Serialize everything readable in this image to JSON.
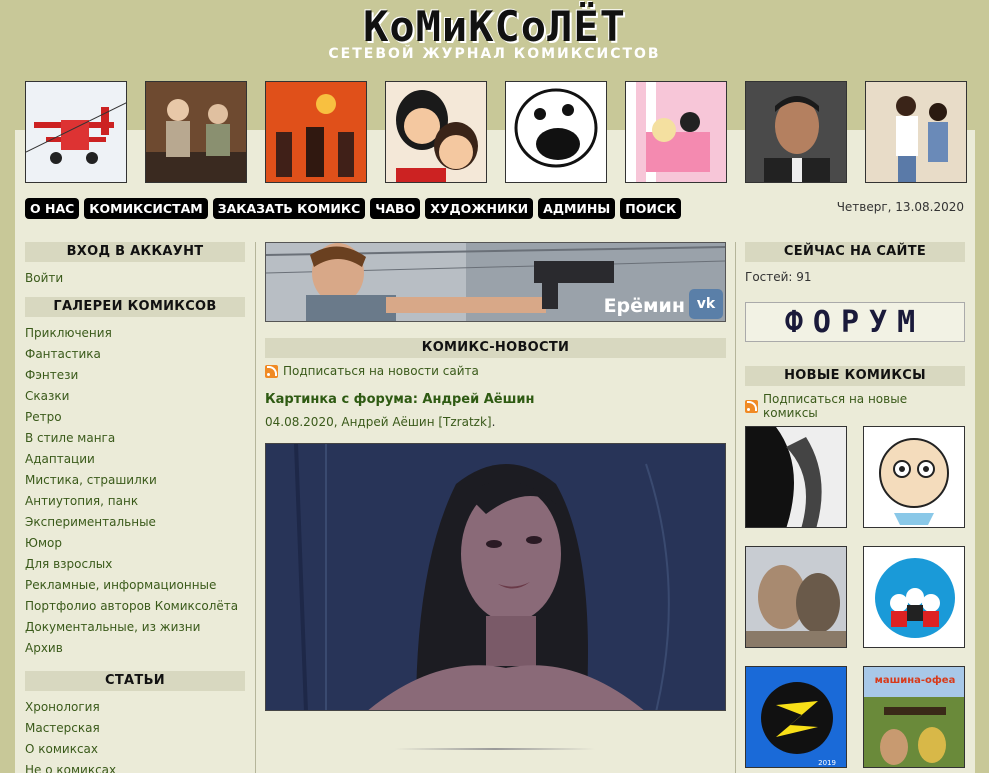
{
  "logo": {
    "title": "КоМиКСоЛЁТ",
    "subtitle": "СЕТЕВОЙ ЖУРНАЛ КОМИКСИСТОВ"
  },
  "thumbs": [
    "biplane-thumb",
    "women-thumb",
    "soldiers-thumb",
    "kids-thumb",
    "monster-thumb",
    "cats-thumb",
    "man-thumb",
    "dance-thumb"
  ],
  "nav": [
    "О НАС",
    "КОМИКСИСТАМ",
    "ЗАКАЗАТЬ КОМИКС",
    "ЧАВО",
    "ХУДОЖНИКИ",
    "АДМИНЫ",
    "ПОИСК"
  ],
  "date": "Четверг, 13.08.2020",
  "left": {
    "login_h": "ВХОД В АККАУНТ",
    "login_link": "Войти",
    "gallery_h": "ГАЛЕРЕИ КОМИКСОВ",
    "gallery": [
      "Приключения",
      "Фантастика",
      "Фэнтези",
      "Сказки",
      "Ретро",
      "В стиле манга",
      "Адаптации",
      "Мистика, страшилки",
      "Антиутопия, панк",
      "Экспериментальные",
      "Юмор",
      "Для взрослых",
      "Рекламные, информационные",
      "Портфолио авторов Комиксолёта",
      "Документальные, из жизни",
      "Архив"
    ],
    "articles_h": "СТАТЬИ",
    "articles": [
      "Хронология",
      "Мастерская",
      "О комиксах",
      "Не о комиксах"
    ]
  },
  "center": {
    "banner_name": "Ерёмин",
    "banner_vk": "vk",
    "news_h": "КОМИКС-НОВОСТИ",
    "subscribe": "Подписаться на новости сайта",
    "post_title": "Картинка с форума: Андрей Аёшин",
    "post_date": "04.08.2020,",
    "post_author": "Андрей Аёшин",
    "post_nick": "[Tzratzk]",
    "post_dot": "."
  },
  "right": {
    "online_h": "СЕЙЧАС НА САЙТЕ",
    "guests": "Гостей: 91",
    "forum": "ФОРУМ",
    "new_h": "НОВЫЕ КОМИКСЫ",
    "subscribe": "Подписаться на новые комиксы",
    "nc_year": "2019",
    "nc_label": "машина-офеа"
  },
  "colors": {
    "bg": "#c8c898",
    "panel": "#ebebd8",
    "link": "#3a5a1a",
    "nav": "#000000"
  }
}
